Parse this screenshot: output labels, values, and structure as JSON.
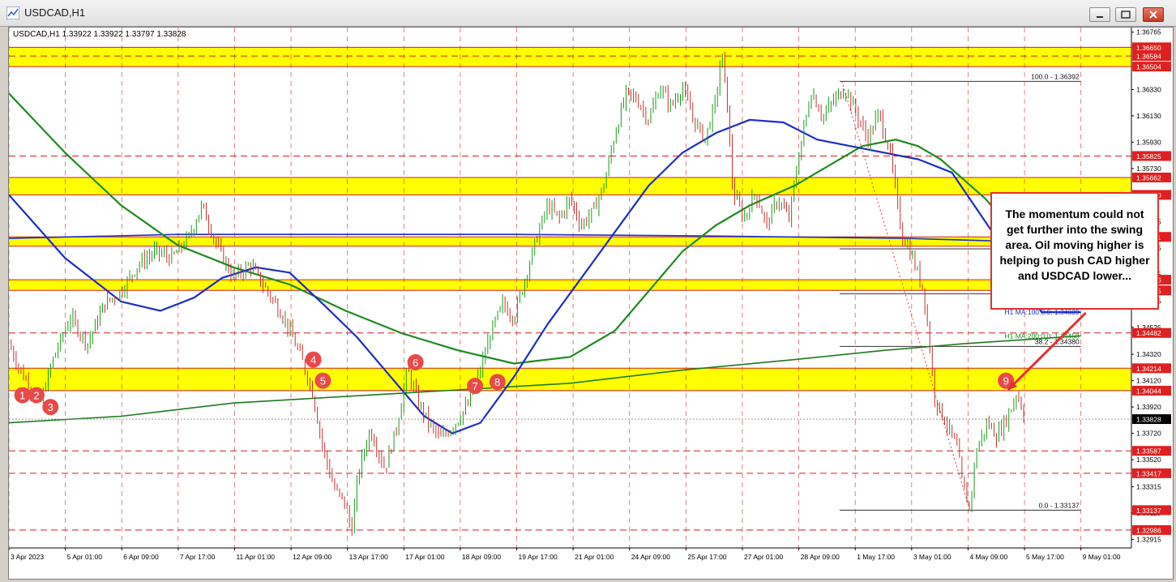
{
  "window": {
    "title": "USDCAD,H1"
  },
  "chart_data": {
    "type": "candlestick",
    "symbol_info": "USDCAD,H1  1.33922 1.33922 1.33797 1.33828",
    "ylim": [
      1.3285,
      1.368
    ],
    "y_ticks": [
      "1.36765",
      "1.36330",
      "1.36130",
      "1.35930",
      "1.35730",
      "1.35325",
      "1.35125",
      "1.34925",
      "1.34725",
      "1.34525",
      "1.34320",
      "1.34120",
      "1.33920",
      "1.33720",
      "1.33520",
      "1.33315",
      "1.33115",
      "1.32915"
    ],
    "x_ticks": [
      "3 Apr 2023",
      "5 Apr 01:00",
      "6 Apr 09:00",
      "7 Apr 17:00",
      "11 Apr 01:00",
      "12 Apr 09:00",
      "13 Apr 17:00",
      "17 Apr 01:00",
      "18 Apr 09:00",
      "19 Apr 17:00",
      "21 Apr 01:00",
      "24 Apr 09:00",
      "25 Apr 17:00",
      "27 Apr 01:00",
      "28 Apr 09:00",
      "1 May 17:00",
      "3 May 01:00",
      "4 May 09:00",
      "5 May 17:00",
      "9 May 01:00"
    ],
    "current_price": "1.33828",
    "zones": [
      {
        "upper": 1.3665,
        "lower": 1.36504
      },
      {
        "upper": 1.35662,
        "lower": 1.3553
      },
      {
        "upper": 1.35211,
        "lower": 1.3514
      },
      {
        "upper": 1.34886,
        "lower": 1.34805
      },
      {
        "upper": 1.34214,
        "lower": 1.34044
      }
    ],
    "level_labels": [
      {
        "value": "1.36650",
        "price": 1.3665
      },
      {
        "value": "1.36584",
        "price": 1.36584
      },
      {
        "value": "1.36504",
        "price": 1.36504
      },
      {
        "value": "1.35825",
        "price": 1.35825
      },
      {
        "value": "1.35662",
        "price": 1.35662
      },
      {
        "value": "1.35530",
        "price": 1.3553
      },
      {
        "value": "1.35211",
        "price": 1.35211
      },
      {
        "value": "1.34886",
        "price": 1.34886
      },
      {
        "value": "1.34805",
        "price": 1.34805
      },
      {
        "value": "1.34482",
        "price": 1.34482
      },
      {
        "value": "1.34214",
        "price": 1.34214
      },
      {
        "value": "1.34044",
        "price": 1.34044
      },
      {
        "value": "1.33587",
        "price": 1.33587
      },
      {
        "value": "1.33417",
        "price": 1.33417
      },
      {
        "value": "1.33137",
        "price": 1.33137
      },
      {
        "value": "1.32986",
        "price": 1.32986
      }
    ],
    "dashed_levels": [
      1.36584,
      1.35825,
      1.34482,
      1.33587,
      1.33417,
      1.32986
    ],
    "fib_levels": [
      {
        "label": "100.0 - 1.36392",
        "price": 1.36392
      },
      {
        "label": "38.2 - 1.34380",
        "price": 1.3438
      },
      {
        "label": "0.0 - 1.33137",
        "price": 1.33137
      }
    ],
    "ma_labels": [
      {
        "label": "H1 MA:100:0:0: 1.34639",
        "price": 1.34639,
        "color": "#1d2ec4"
      },
      {
        "label": "H1 MA:200:0:0: 1.34458",
        "price": 1.34458,
        "color": "#1e8a1e"
      }
    ],
    "markers": [
      {
        "label": "1",
        "x": 0.0048,
        "price": 1.3401
      },
      {
        "label": "2",
        "x": 0.0173,
        "price": 1.3401
      },
      {
        "label": "3",
        "x": 0.0298,
        "price": 1.3392
      },
      {
        "label": "4",
        "x": 0.264,
        "price": 1.3428
      },
      {
        "label": "5",
        "x": 0.2725,
        "price": 1.3412
      },
      {
        "label": "6",
        "x": 0.355,
        "price": 1.3426
      },
      {
        "label": "7",
        "x": 0.408,
        "price": 1.3408
      },
      {
        "label": "8",
        "x": 0.428,
        "price": 1.3411
      },
      {
        "label": "9",
        "x": 0.881,
        "price": 1.3412
      }
    ],
    "price_path": [
      [
        0.0,
        1.344
      ],
      [
        0.01,
        1.342
      ],
      [
        0.02,
        1.3405
      ],
      [
        0.028,
        1.3395
      ],
      [
        0.04,
        1.343
      ],
      [
        0.055,
        1.346
      ],
      [
        0.07,
        1.344
      ],
      [
        0.085,
        1.347
      ],
      [
        0.1,
        1.348
      ],
      [
        0.115,
        1.35
      ],
      [
        0.13,
        1.351
      ],
      [
        0.145,
        1.3505
      ],
      [
        0.16,
        1.352
      ],
      [
        0.172,
        1.3545
      ],
      [
        0.185,
        1.3515
      ],
      [
        0.2,
        1.349
      ],
      [
        0.215,
        1.35
      ],
      [
        0.23,
        1.348
      ],
      [
        0.245,
        1.346
      ],
      [
        0.26,
        1.343
      ],
      [
        0.27,
        1.3405
      ],
      [
        0.28,
        1.336
      ],
      [
        0.29,
        1.333
      ],
      [
        0.3,
        1.3318
      ],
      [
        0.305,
        1.3297
      ],
      [
        0.312,
        1.3345
      ],
      [
        0.322,
        1.3375
      ],
      [
        0.335,
        1.3345
      ],
      [
        0.345,
        1.3375
      ],
      [
        0.355,
        1.342
      ],
      [
        0.365,
        1.3395
      ],
      [
        0.375,
        1.3378
      ],
      [
        0.385,
        1.3368
      ],
      [
        0.398,
        1.338
      ],
      [
        0.41,
        1.3395
      ],
      [
        0.42,
        1.342
      ],
      [
        0.43,
        1.345
      ],
      [
        0.44,
        1.347
      ],
      [
        0.45,
        1.346
      ],
      [
        0.46,
        1.349
      ],
      [
        0.47,
        1.352
      ],
      [
        0.48,
        1.3545
      ],
      [
        0.49,
        1.3535
      ],
      [
        0.5,
        1.355
      ],
      [
        0.51,
        1.353
      ],
      [
        0.52,
        1.354
      ],
      [
        0.53,
        1.356
      ],
      [
        0.54,
        1.36
      ],
      [
        0.55,
        1.363
      ],
      [
        0.56,
        1.3625
      ],
      [
        0.57,
        1.361
      ],
      [
        0.58,
        1.3635
      ],
      [
        0.59,
        1.362
      ],
      [
        0.6,
        1.3635
      ],
      [
        0.61,
        1.361
      ],
      [
        0.62,
        1.3595
      ],
      [
        0.63,
        1.3625
      ],
      [
        0.635,
        1.3662
      ],
      [
        0.64,
        1.362
      ],
      [
        0.645,
        1.3555
      ],
      [
        0.655,
        1.3535
      ],
      [
        0.665,
        1.3555
      ],
      [
        0.675,
        1.353
      ],
      [
        0.685,
        1.355
      ],
      [
        0.695,
        1.3535
      ],
      [
        0.705,
        1.359
      ],
      [
        0.715,
        1.3632
      ],
      [
        0.725,
        1.3612
      ],
      [
        0.735,
        1.3625
      ],
      [
        0.745,
        1.3634
      ],
      [
        0.755,
        1.3615
      ],
      [
        0.765,
        1.3595
      ],
      [
        0.775,
        1.3615
      ],
      [
        0.785,
        1.3585
      ],
      [
        0.795,
        1.3525
      ],
      [
        0.805,
        1.3505
      ],
      [
        0.815,
        1.348
      ],
      [
        0.82,
        1.344
      ],
      [
        0.825,
        1.3398
      ],
      [
        0.835,
        1.338
      ],
      [
        0.845,
        1.336
      ],
      [
        0.85,
        1.333
      ],
      [
        0.856,
        1.3316
      ],
      [
        0.862,
        1.336
      ],
      [
        0.872,
        1.338
      ],
      [
        0.88,
        1.337
      ],
      [
        0.89,
        1.3385
      ],
      [
        0.898,
        1.3403
      ],
      [
        0.905,
        1.3385
      ]
    ],
    "ma100_blue": [
      [
        0.0,
        1.3553
      ],
      [
        0.05,
        1.3505
      ],
      [
        0.1,
        1.3472
      ],
      [
        0.135,
        1.3465
      ],
      [
        0.165,
        1.3475
      ],
      [
        0.19,
        1.349
      ],
      [
        0.22,
        1.3498
      ],
      [
        0.25,
        1.3494
      ],
      [
        0.28,
        1.347
      ],
      [
        0.31,
        1.3445
      ],
      [
        0.34,
        1.3415
      ],
      [
        0.37,
        1.3385
      ],
      [
        0.395,
        1.3372
      ],
      [
        0.42,
        1.338
      ],
      [
        0.45,
        1.3415
      ],
      [
        0.48,
        1.3455
      ],
      [
        0.51,
        1.349
      ],
      [
        0.54,
        1.3525
      ],
      [
        0.57,
        1.356
      ],
      [
        0.6,
        1.3585
      ],
      [
        0.63,
        1.36
      ],
      [
        0.66,
        1.361
      ],
      [
        0.69,
        1.3608
      ],
      [
        0.72,
        1.3595
      ],
      [
        0.75,
        1.359
      ],
      [
        0.78,
        1.3585
      ],
      [
        0.81,
        1.358
      ],
      [
        0.84,
        1.357
      ],
      [
        0.86,
        1.3545
      ],
      [
        0.88,
        1.352
      ],
      [
        0.9,
        1.349
      ],
      [
        0.92,
        1.3464
      ],
      [
        0.955,
        1.3464
      ]
    ],
    "ma200_green": [
      [
        0.0,
        1.363
      ],
      [
        0.05,
        1.3585
      ],
      [
        0.1,
        1.3545
      ],
      [
        0.15,
        1.3515
      ],
      [
        0.2,
        1.3498
      ],
      [
        0.25,
        1.3485
      ],
      [
        0.3,
        1.3465
      ],
      [
        0.35,
        1.3448
      ],
      [
        0.4,
        1.3435
      ],
      [
        0.45,
        1.3425
      ],
      [
        0.5,
        1.343
      ],
      [
        0.54,
        1.345
      ],
      [
        0.57,
        1.348
      ],
      [
        0.6,
        1.351
      ],
      [
        0.63,
        1.353
      ],
      [
        0.66,
        1.3545
      ],
      [
        0.7,
        1.356
      ],
      [
        0.73,
        1.3575
      ],
      [
        0.76,
        1.359
      ],
      [
        0.79,
        1.3595
      ],
      [
        0.81,
        1.359
      ],
      [
        0.83,
        1.358
      ],
      [
        0.85,
        1.3565
      ],
      [
        0.87,
        1.355
      ],
      [
        0.89,
        1.353
      ]
    ],
    "step_blue": [
      [
        0.0,
        1.352
      ],
      [
        0.15,
        1.3523
      ],
      [
        0.3,
        1.3523
      ],
      [
        0.45,
        1.3523
      ],
      [
        0.6,
        1.3522
      ],
      [
        0.7,
        1.3521
      ],
      [
        0.8,
        1.352
      ],
      [
        0.88,
        1.3518
      ]
    ],
    "step_green": [
      [
        0.0,
        1.338
      ],
      [
        0.1,
        1.3385
      ],
      [
        0.2,
        1.3395
      ],
      [
        0.3,
        1.34
      ],
      [
        0.4,
        1.3405
      ],
      [
        0.5,
        1.341
      ],
      [
        0.6,
        1.342
      ],
      [
        0.7,
        1.3428
      ],
      [
        0.78,
        1.3435
      ],
      [
        0.85,
        1.344
      ],
      [
        0.955,
        1.3446
      ]
    ],
    "arrow": {
      "from": [
        0.955,
        1.3445
      ],
      "to": [
        0.88,
        1.3405
      ]
    }
  },
  "annotation": {
    "text": "The momentum could not get further into the swing area. Oil moving higher is helping to push CAD higher and USDCAD lower..."
  }
}
